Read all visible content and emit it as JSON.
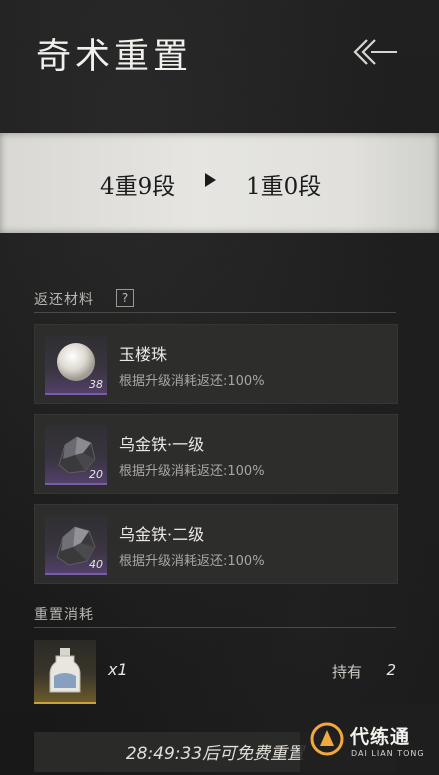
{
  "header": {
    "title": "奇术重置"
  },
  "banner": {
    "from_level": "4重9段",
    "to_level": "1重0段"
  },
  "return_section": {
    "label": "返还材料",
    "help_symbol": "?",
    "items": [
      {
        "name": "玉楼珠",
        "desc": "根据升级消耗返还:100%",
        "qty": "38",
        "icon": "pearl-icon"
      },
      {
        "name": "乌金铁·一级",
        "desc": "根据升级消耗返还:100%",
        "qty": "20",
        "icon": "ore-icon"
      },
      {
        "name": "乌金铁·二级",
        "desc": "根据升级消耗返还:100%",
        "qty": "40",
        "icon": "ore-icon"
      }
    ]
  },
  "cost_section": {
    "label": "重置消耗",
    "item_icon": "potion-bottle-icon",
    "qty": "x1",
    "have_label": "持有",
    "have_value": "2"
  },
  "footer": {
    "timer_text": "28:49:33后可免费重置"
  },
  "watermark": {
    "cn": "代练通",
    "en": "DAI LIAN TONG"
  },
  "colors": {
    "accent_purple": "#7c5ba8",
    "accent_gold": "#c9a23c",
    "banner_bg": "#e1e0dc"
  }
}
